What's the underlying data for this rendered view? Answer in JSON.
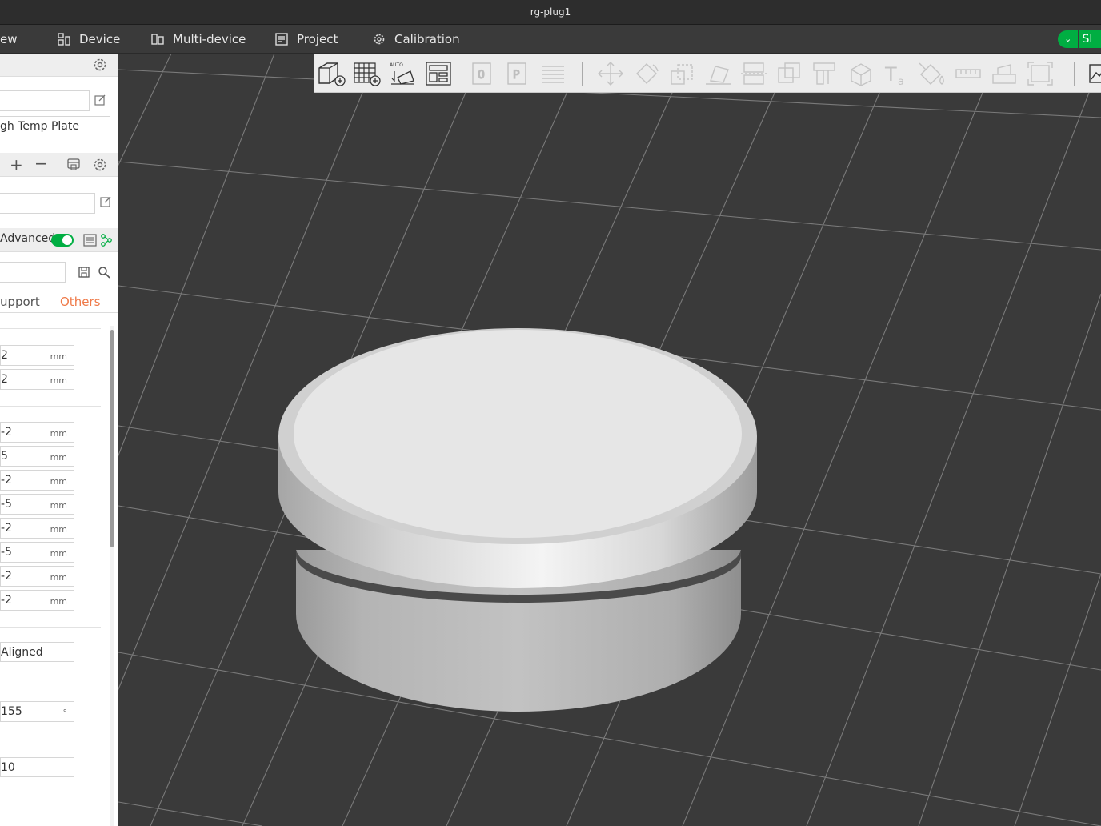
{
  "window": {
    "title": "rg-plug1"
  },
  "menubar": {
    "prepare_partial": "ew",
    "device": "Device",
    "multi_device": "Multi-device",
    "project": "Project",
    "calibration": "Calibration",
    "slice_label_partial": "Sl"
  },
  "sidebar": {
    "plate_type": "gh Temp Plate",
    "advanced_label": "Advanced",
    "advanced_on": true,
    "tabs": {
      "support_partial": "upport",
      "others": "Others"
    },
    "fields_group1": [
      {
        "value": "2",
        "unit": "mm"
      },
      {
        "value": "2",
        "unit": "mm"
      }
    ],
    "fields_group2": [
      {
        "value": "-2",
        "unit": "mm"
      },
      {
        "value": "5",
        "unit": "mm"
      },
      {
        "value": "-2",
        "unit": "mm"
      },
      {
        "value": "-5",
        "unit": "mm"
      },
      {
        "value": "-2",
        "unit": "mm"
      },
      {
        "value": "-5",
        "unit": "mm"
      },
      {
        "value": "-2",
        "unit": "mm"
      },
      {
        "value": "-2",
        "unit": "mm"
      }
    ],
    "seam_position": "Aligned",
    "angle_value": "155",
    "angle_unit": "°",
    "last_value": "10"
  },
  "colors": {
    "accent_green": "#00ae42",
    "tab_active": "#ef7a49",
    "bed": "#3a3a3a",
    "grid": "#7c7c7c"
  }
}
